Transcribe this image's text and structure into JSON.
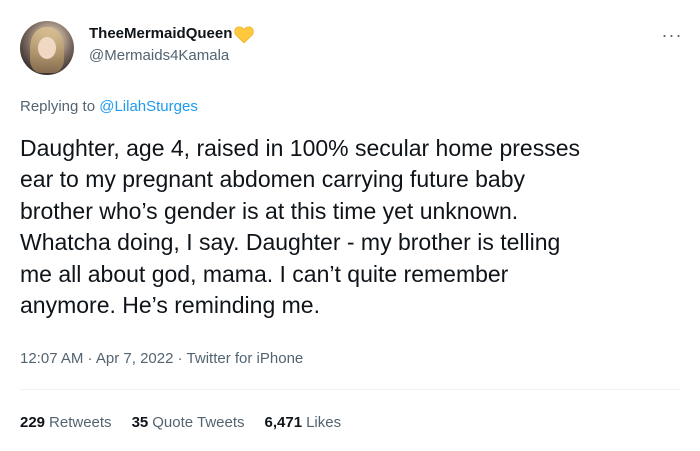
{
  "author": {
    "display_name": "TheeMermaidQueen",
    "handle": "@Mermaids4Kamala",
    "badge_icon": "yellow-heart-icon",
    "badge_color": "#ffc83d"
  },
  "reply": {
    "prefix": "Replying to ",
    "mention": "@LilahSturges"
  },
  "tweet": {
    "text": "Daughter, age 4, raised in 100% secular home presses\near to my pregnant abdomen carrying future baby\nbrother who’s gender is at this time yet unknown.\nWhatcha doing, I say. Daughter - my brother is telling\nme all about god, mama. I can’t quite remember\nanymore. He’s reminding me."
  },
  "meta": {
    "time": "12:07 AM",
    "sep1": " · ",
    "date": "Apr 7, 2022",
    "sep2": " · ",
    "source": "Twitter for iPhone"
  },
  "stats": {
    "retweets_count": "229",
    "retweets_label": "Retweets",
    "quotes_count": "35",
    "quotes_label": "Quote Tweets",
    "likes_count": "6,471",
    "likes_label": "Likes"
  },
  "more_icon": "more-horizontal-icon",
  "colors": {
    "accent": "#1d9bf0",
    "text": "#0f1419",
    "secondary": "#536471",
    "divider": "#eff3f4"
  }
}
